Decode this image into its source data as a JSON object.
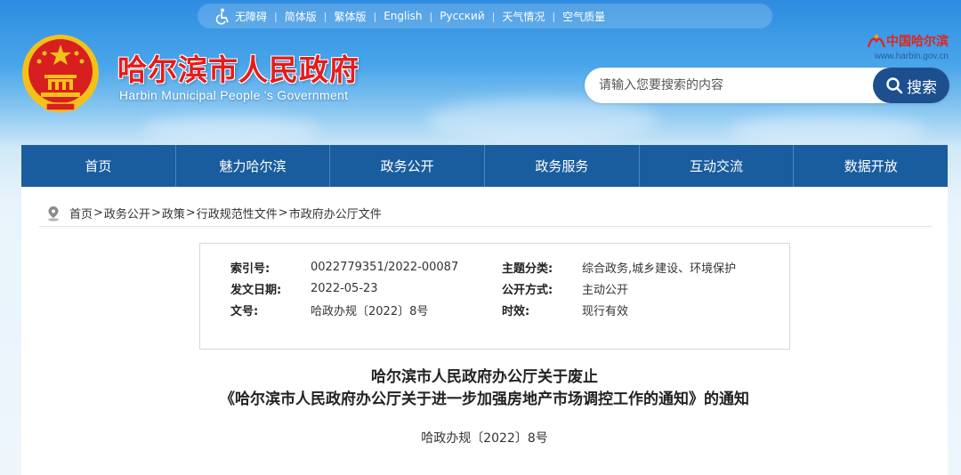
{
  "topbar": {
    "links": [
      "无障碍",
      "简体版",
      "繁体版",
      "English",
      "Русский",
      "天气情况",
      "空气质量"
    ]
  },
  "header": {
    "title": "哈尔滨市人民政府",
    "subtitle": "Harbin Municipal People 's Government",
    "brand_name": "中国哈尔滨",
    "brand_url": "www.harbin.gov.cn"
  },
  "search": {
    "placeholder": "请输入您要搜索的内容",
    "button_label": "搜索"
  },
  "nav": {
    "items": [
      "首页",
      "魅力哈尔滨",
      "政务公开",
      "政务服务",
      "互动交流",
      "数据开放"
    ]
  },
  "breadcrumb": [
    "首页",
    "政务公开",
    "政策",
    "行政规范性文件",
    "市政府办公厅文件"
  ],
  "meta": {
    "index_label": "索引号:",
    "index_value": "0022779351/2022-00087",
    "category_label": "主题分类:",
    "category_value": "综合政务,城乡建设、环境保护",
    "date_label": "发文日期:",
    "date_value": "2022-05-23",
    "open_label": "公开方式:",
    "open_value": "主动公开",
    "docno_label": "文号:",
    "docno_value": "哈政办规〔2022〕8号",
    "validity_label": "时效:",
    "validity_value": "现行有效"
  },
  "document": {
    "title_line1": "哈尔滨市人民政府办公厅关于废止",
    "title_line2": "《哈尔滨市人民政府办公厅关于进一步加强房地产市场调控工作的通知》的通知",
    "doc_number": "哈政办规〔2022〕8号"
  },
  "colors": {
    "nav_bg": "#1a5d9e",
    "title_red": "#e41c1c",
    "search_button": "#1d4f8e"
  }
}
